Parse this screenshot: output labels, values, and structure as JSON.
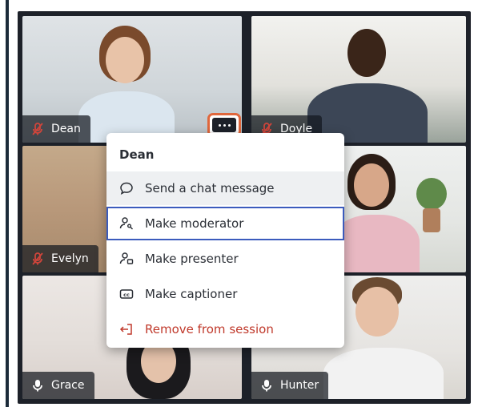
{
  "participants": {
    "dean": {
      "name": "Dean"
    },
    "doyle": {
      "name": "Doyle"
    },
    "evelyn": {
      "name": "Evelyn"
    },
    "grace": {
      "name": "Grace"
    },
    "hunter": {
      "name": "Hunter"
    }
  },
  "context_menu": {
    "header": "Dean",
    "items": [
      {
        "label": "Send a chat message",
        "icon": "chat-bubble-icon"
      },
      {
        "label": "Make moderator",
        "icon": "person-key-icon"
      },
      {
        "label": "Make presenter",
        "icon": "presenter-icon"
      },
      {
        "label": "Make captioner",
        "icon": "cc-icon"
      },
      {
        "label": "Remove from session",
        "icon": "remove-exit-icon"
      }
    ]
  },
  "colors": {
    "accent_orange": "#e0673c",
    "focus_blue": "#3b5bbd",
    "danger_red": "#c0392b",
    "muted_red": "#d0453b"
  }
}
